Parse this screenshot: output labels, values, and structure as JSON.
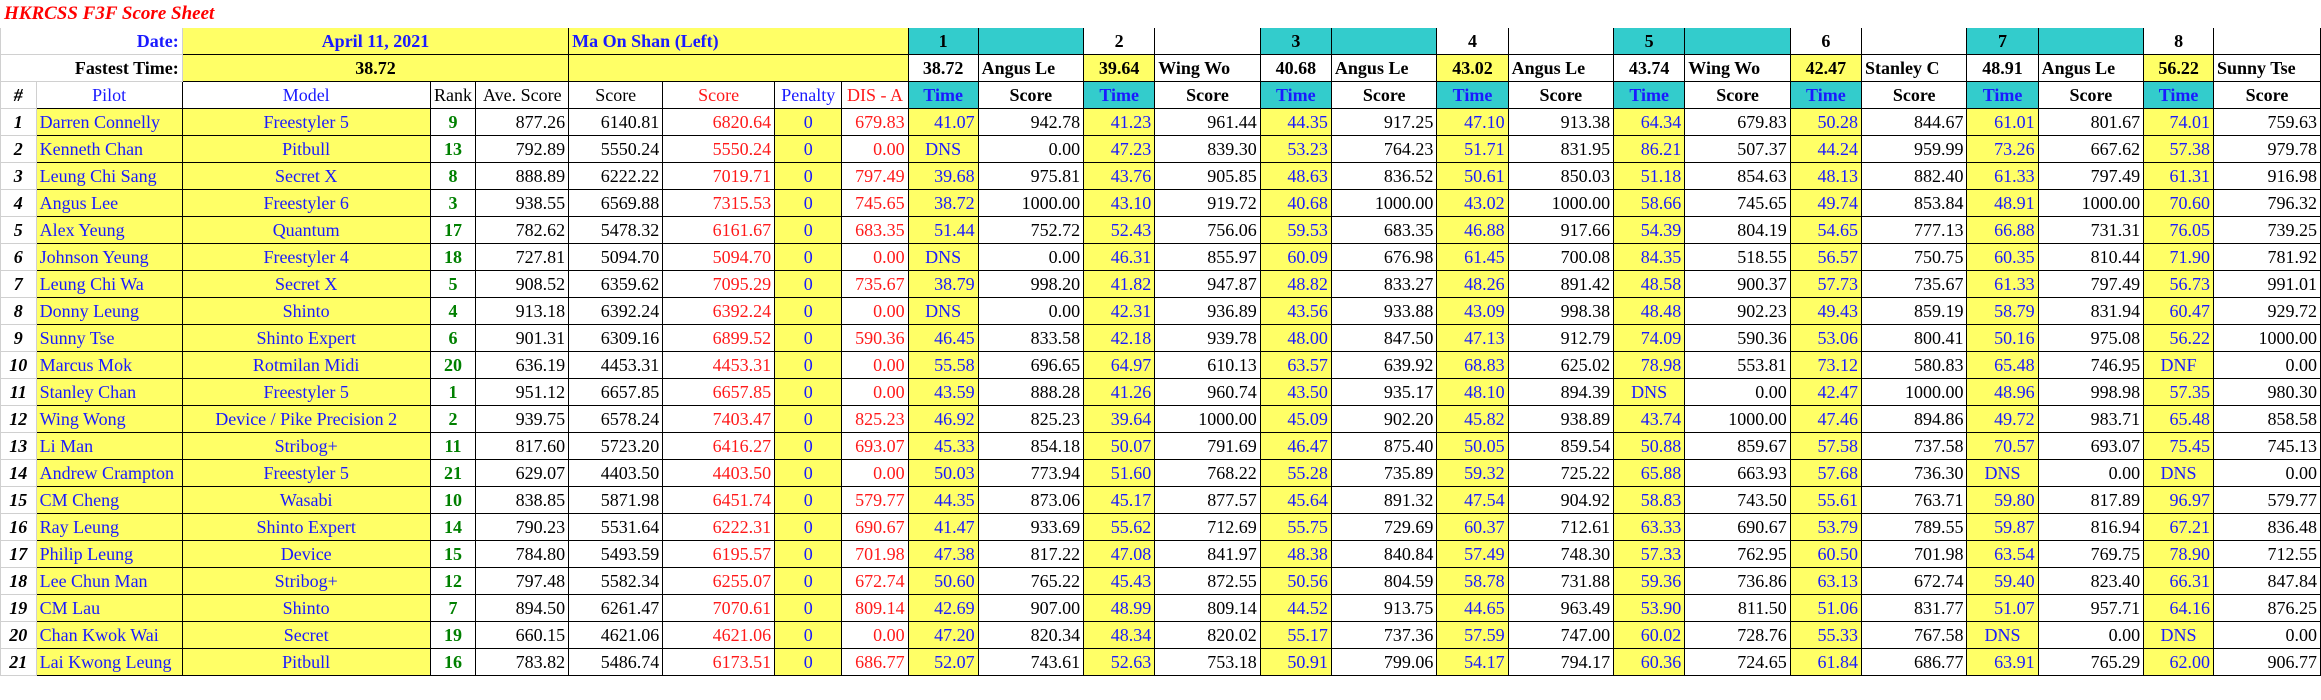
{
  "title": "HKRCSS F3F Score Sheet",
  "date_label": "Date:",
  "date_value": "April 11, 2021",
  "site": "Ma On Shan (Left)",
  "fastest_label": "Fastest Time:",
  "fastest_value": "38.72",
  "rounds": [
    {
      "number": "1",
      "best_time": "38.72",
      "best_pilot": "Angus Le"
    },
    {
      "number": "2",
      "best_time": "39.64",
      "best_pilot": "Wing Wo"
    },
    {
      "number": "3",
      "best_time": "40.68",
      "best_pilot": "Angus Le"
    },
    {
      "number": "4",
      "best_time": "43.02",
      "best_pilot": "Angus Le"
    },
    {
      "number": "5",
      "best_time": "43.74",
      "best_pilot": "Wing Wo"
    },
    {
      "number": "6",
      "best_time": "42.47",
      "best_pilot": "Stanley C"
    },
    {
      "number": "7",
      "best_time": "48.91",
      "best_pilot": "Angus Le"
    },
    {
      "number": "8",
      "best_time": "56.22",
      "best_pilot": "Sunny Tse"
    }
  ],
  "headers": {
    "num": "#",
    "pilot": "Pilot",
    "model": "Model",
    "rank": "Rank",
    "ave_score": "Ave. Score",
    "score": "Score",
    "score_red": "Score",
    "penalty": "Penalty",
    "dis": "DIS - A",
    "time": "Time",
    "round_score": "Score"
  },
  "pilots": [
    {
      "n": "1",
      "pilot": "Darren Connelly",
      "model": "Freestyler 5",
      "rank": "9",
      "ave": "877.26",
      "score": "6140.81",
      "score2": "6820.64",
      "penalty": "0",
      "dis": "679.83",
      "rounds": [
        [
          "41.07",
          "942.78"
        ],
        [
          "41.23",
          "961.44"
        ],
        [
          "44.35",
          "917.25"
        ],
        [
          "47.10",
          "913.38"
        ],
        [
          "64.34",
          "679.83"
        ],
        [
          "50.28",
          "844.67"
        ],
        [
          "61.01",
          "801.67"
        ],
        [
          "74.01",
          "759.63"
        ]
      ]
    },
    {
      "n": "2",
      "pilot": "Kenneth Chan",
      "model": "Pitbull",
      "rank": "13",
      "ave": "792.89",
      "score": "5550.24",
      "score2": "5550.24",
      "penalty": "0",
      "dis": "0.00",
      "rounds": [
        [
          "DNS",
          "0.00"
        ],
        [
          "47.23",
          "839.30"
        ],
        [
          "53.23",
          "764.23"
        ],
        [
          "51.71",
          "831.95"
        ],
        [
          "86.21",
          "507.37"
        ],
        [
          "44.24",
          "959.99"
        ],
        [
          "73.26",
          "667.62"
        ],
        [
          "57.38",
          "979.78"
        ]
      ]
    },
    {
      "n": "3",
      "pilot": "Leung Chi Sang",
      "model": "Secret X",
      "rank": "8",
      "ave": "888.89",
      "score": "6222.22",
      "score2": "7019.71",
      "penalty": "0",
      "dis": "797.49",
      "rounds": [
        [
          "39.68",
          "975.81"
        ],
        [
          "43.76",
          "905.85"
        ],
        [
          "48.63",
          "836.52"
        ],
        [
          "50.61",
          "850.03"
        ],
        [
          "51.18",
          "854.63"
        ],
        [
          "48.13",
          "882.40"
        ],
        [
          "61.33",
          "797.49"
        ],
        [
          "61.31",
          "916.98"
        ]
      ]
    },
    {
      "n": "4",
      "pilot": "Angus Lee",
      "model": "Freestyler 6",
      "rank": "3",
      "ave": "938.55",
      "score": "6569.88",
      "score2": "7315.53",
      "penalty": "0",
      "dis": "745.65",
      "rounds": [
        [
          "38.72",
          "1000.00"
        ],
        [
          "43.10",
          "919.72"
        ],
        [
          "40.68",
          "1000.00"
        ],
        [
          "43.02",
          "1000.00"
        ],
        [
          "58.66",
          "745.65"
        ],
        [
          "49.74",
          "853.84"
        ],
        [
          "48.91",
          "1000.00"
        ],
        [
          "70.60",
          "796.32"
        ]
      ]
    },
    {
      "n": "5",
      "pilot": "Alex Yeung",
      "model": "Quantum",
      "rank": "17",
      "ave": "782.62",
      "score": "5478.32",
      "score2": "6161.67",
      "penalty": "0",
      "dis": "683.35",
      "rounds": [
        [
          "51.44",
          "752.72"
        ],
        [
          "52.43",
          "756.06"
        ],
        [
          "59.53",
          "683.35"
        ],
        [
          "46.88",
          "917.66"
        ],
        [
          "54.39",
          "804.19"
        ],
        [
          "54.65",
          "777.13"
        ],
        [
          "66.88",
          "731.31"
        ],
        [
          "76.05",
          "739.25"
        ]
      ]
    },
    {
      "n": "6",
      "pilot": "Johnson Yeung",
      "model": "Freestyler 4",
      "rank": "18",
      "ave": "727.81",
      "score": "5094.70",
      "score2": "5094.70",
      "penalty": "0",
      "dis": "0.00",
      "rounds": [
        [
          "DNS",
          "0.00"
        ],
        [
          "46.31",
          "855.97"
        ],
        [
          "60.09",
          "676.98"
        ],
        [
          "61.45",
          "700.08"
        ],
        [
          "84.35",
          "518.55"
        ],
        [
          "56.57",
          "750.75"
        ],
        [
          "60.35",
          "810.44"
        ],
        [
          "71.90",
          "781.92"
        ]
      ]
    },
    {
      "n": "7",
      "pilot": "Leung Chi Wa",
      "model": "Secret X",
      "rank": "5",
      "ave": "908.52",
      "score": "6359.62",
      "score2": "7095.29",
      "penalty": "0",
      "dis": "735.67",
      "rounds": [
        [
          "38.79",
          "998.20"
        ],
        [
          "41.82",
          "947.87"
        ],
        [
          "48.82",
          "833.27"
        ],
        [
          "48.26",
          "891.42"
        ],
        [
          "48.58",
          "900.37"
        ],
        [
          "57.73",
          "735.67"
        ],
        [
          "61.33",
          "797.49"
        ],
        [
          "56.73",
          "991.01"
        ]
      ]
    },
    {
      "n": "8",
      "pilot": "Donny Leung",
      "model": "Shinto",
      "rank": "4",
      "ave": "913.18",
      "score": "6392.24",
      "score2": "6392.24",
      "penalty": "0",
      "dis": "0.00",
      "rounds": [
        [
          "DNS",
          "0.00"
        ],
        [
          "42.31",
          "936.89"
        ],
        [
          "43.56",
          "933.88"
        ],
        [
          "43.09",
          "998.38"
        ],
        [
          "48.48",
          "902.23"
        ],
        [
          "49.43",
          "859.19"
        ],
        [
          "58.79",
          "831.94"
        ],
        [
          "60.47",
          "929.72"
        ]
      ]
    },
    {
      "n": "9",
      "pilot": "Sunny Tse",
      "model": "Shinto Expert",
      "rank": "6",
      "ave": "901.31",
      "score": "6309.16",
      "score2": "6899.52",
      "penalty": "0",
      "dis": "590.36",
      "rounds": [
        [
          "46.45",
          "833.58"
        ],
        [
          "42.18",
          "939.78"
        ],
        [
          "48.00",
          "847.50"
        ],
        [
          "47.13",
          "912.79"
        ],
        [
          "74.09",
          "590.36"
        ],
        [
          "53.06",
          "800.41"
        ],
        [
          "50.16",
          "975.08"
        ],
        [
          "56.22",
          "1000.00"
        ]
      ]
    },
    {
      "n": "10",
      "pilot": "Marcus Mok",
      "model": "Rotmilan Midi",
      "rank": "20",
      "ave": "636.19",
      "score": "4453.31",
      "score2": "4453.31",
      "penalty": "0",
      "dis": "0.00",
      "rounds": [
        [
          "55.58",
          "696.65"
        ],
        [
          "64.97",
          "610.13"
        ],
        [
          "63.57",
          "639.92"
        ],
        [
          "68.83",
          "625.02"
        ],
        [
          "78.98",
          "553.81"
        ],
        [
          "73.12",
          "580.83"
        ],
        [
          "65.48",
          "746.95"
        ],
        [
          "DNF",
          "0.00"
        ]
      ]
    },
    {
      "n": "11",
      "pilot": "Stanley Chan",
      "model": "Freestyler 5",
      "rank": "1",
      "ave": "951.12",
      "score": "6657.85",
      "score2": "6657.85",
      "penalty": "0",
      "dis": "0.00",
      "rounds": [
        [
          "43.59",
          "888.28"
        ],
        [
          "41.26",
          "960.74"
        ],
        [
          "43.50",
          "935.17"
        ],
        [
          "48.10",
          "894.39"
        ],
        [
          "DNS",
          "0.00"
        ],
        [
          "42.47",
          "1000.00"
        ],
        [
          "48.96",
          "998.98"
        ],
        [
          "57.35",
          "980.30"
        ]
      ]
    },
    {
      "n": "12",
      "pilot": "Wing Wong",
      "model": "Device / Pike Precision 2",
      "rank": "2",
      "ave": "939.75",
      "score": "6578.24",
      "score2": "7403.47",
      "penalty": "0",
      "dis": "825.23",
      "rounds": [
        [
          "46.92",
          "825.23"
        ],
        [
          "39.64",
          "1000.00"
        ],
        [
          "45.09",
          "902.20"
        ],
        [
          "45.82",
          "938.89"
        ],
        [
          "43.74",
          "1000.00"
        ],
        [
          "47.46",
          "894.86"
        ],
        [
          "49.72",
          "983.71"
        ],
        [
          "65.48",
          "858.58"
        ]
      ]
    },
    {
      "n": "13",
      "pilot": "Li Man",
      "model": "Stribog+",
      "rank": "11",
      "ave": "817.60",
      "score": "5723.20",
      "score2": "6416.27",
      "penalty": "0",
      "dis": "693.07",
      "rounds": [
        [
          "45.33",
          "854.18"
        ],
        [
          "50.07",
          "791.69"
        ],
        [
          "46.47",
          "875.40"
        ],
        [
          "50.05",
          "859.54"
        ],
        [
          "50.88",
          "859.67"
        ],
        [
          "57.58",
          "737.58"
        ],
        [
          "70.57",
          "693.07"
        ],
        [
          "75.45",
          "745.13"
        ]
      ]
    },
    {
      "n": "14",
      "pilot": "Andrew Crampton",
      "model": "Freestyler 5",
      "rank": "21",
      "ave": "629.07",
      "score": "4403.50",
      "score2": "4403.50",
      "penalty": "0",
      "dis": "0.00",
      "rounds": [
        [
          "50.03",
          "773.94"
        ],
        [
          "51.60",
          "768.22"
        ],
        [
          "55.28",
          "735.89"
        ],
        [
          "59.32",
          "725.22"
        ],
        [
          "65.88",
          "663.93"
        ],
        [
          "57.68",
          "736.30"
        ],
        [
          "DNS",
          "0.00"
        ],
        [
          "DNS",
          "0.00"
        ]
      ]
    },
    {
      "n": "15",
      "pilot": "CM Cheng",
      "model": "Wasabi",
      "rank": "10",
      "ave": "838.85",
      "score": "5871.98",
      "score2": "6451.74",
      "penalty": "0",
      "dis": "579.77",
      "rounds": [
        [
          "44.35",
          "873.06"
        ],
        [
          "45.17",
          "877.57"
        ],
        [
          "45.64",
          "891.32"
        ],
        [
          "47.54",
          "904.92"
        ],
        [
          "58.83",
          "743.50"
        ],
        [
          "55.61",
          "763.71"
        ],
        [
          "59.80",
          "817.89"
        ],
        [
          "96.97",
          "579.77"
        ]
      ]
    },
    {
      "n": "16",
      "pilot": "Ray Leung",
      "model": "Shinto Expert",
      "rank": "14",
      "ave": "790.23",
      "score": "5531.64",
      "score2": "6222.31",
      "penalty": "0",
      "dis": "690.67",
      "rounds": [
        [
          "41.47",
          "933.69"
        ],
        [
          "55.62",
          "712.69"
        ],
        [
          "55.75",
          "729.69"
        ],
        [
          "60.37",
          "712.61"
        ],
        [
          "63.33",
          "690.67"
        ],
        [
          "53.79",
          "789.55"
        ],
        [
          "59.87",
          "816.94"
        ],
        [
          "67.21",
          "836.48"
        ]
      ]
    },
    {
      "n": "17",
      "pilot": "Philip Leung",
      "model": "Device",
      "rank": "15",
      "ave": "784.80",
      "score": "5493.59",
      "score2": "6195.57",
      "penalty": "0",
      "dis": "701.98",
      "rounds": [
        [
          "47.38",
          "817.22"
        ],
        [
          "47.08",
          "841.97"
        ],
        [
          "48.38",
          "840.84"
        ],
        [
          "57.49",
          "748.30"
        ],
        [
          "57.33",
          "762.95"
        ],
        [
          "60.50",
          "701.98"
        ],
        [
          "63.54",
          "769.75"
        ],
        [
          "78.90",
          "712.55"
        ]
      ]
    },
    {
      "n": "18",
      "pilot": "Lee Chun Man",
      "model": "Stribog+",
      "rank": "12",
      "ave": "797.48",
      "score": "5582.34",
      "score2": "6255.07",
      "penalty": "0",
      "dis": "672.74",
      "rounds": [
        [
          "50.60",
          "765.22"
        ],
        [
          "45.43",
          "872.55"
        ],
        [
          "50.56",
          "804.59"
        ],
        [
          "58.78",
          "731.88"
        ],
        [
          "59.36",
          "736.86"
        ],
        [
          "63.13",
          "672.74"
        ],
        [
          "59.40",
          "823.40"
        ],
        [
          "66.31",
          "847.84"
        ]
      ]
    },
    {
      "n": "19",
      "pilot": "CM Lau",
      "model": "Shinto",
      "rank": "7",
      "ave": "894.50",
      "score": "6261.47",
      "score2": "7070.61",
      "penalty": "0",
      "dis": "809.14",
      "rounds": [
        [
          "42.69",
          "907.00"
        ],
        [
          "48.99",
          "809.14"
        ],
        [
          "44.52",
          "913.75"
        ],
        [
          "44.65",
          "963.49"
        ],
        [
          "53.90",
          "811.50"
        ],
        [
          "51.06",
          "831.77"
        ],
        [
          "51.07",
          "957.71"
        ],
        [
          "64.16",
          "876.25"
        ]
      ]
    },
    {
      "n": "20",
      "pilot": "Chan Kwok Wai",
      "model": "Secret",
      "rank": "19",
      "ave": "660.15",
      "score": "4621.06",
      "score2": "4621.06",
      "penalty": "0",
      "dis": "0.00",
      "rounds": [
        [
          "47.20",
          "820.34"
        ],
        [
          "48.34",
          "820.02"
        ],
        [
          "55.17",
          "737.36"
        ],
        [
          "57.59",
          "747.00"
        ],
        [
          "60.02",
          "728.76"
        ],
        [
          "55.33",
          "767.58"
        ],
        [
          "DNS",
          "0.00"
        ],
        [
          "DNS",
          "0.00"
        ]
      ]
    },
    {
      "n": "21",
      "pilot": "Lai Kwong Leung",
      "model": "Pitbull",
      "rank": "16",
      "ave": "783.82",
      "score": "5486.74",
      "score2": "6173.51",
      "penalty": "0",
      "dis": "686.77",
      "rounds": [
        [
          "52.07",
          "743.61"
        ],
        [
          "52.63",
          "753.18"
        ],
        [
          "50.91",
          "799.06"
        ],
        [
          "54.17",
          "794.17"
        ],
        [
          "60.36",
          "724.65"
        ],
        [
          "61.84",
          "686.77"
        ],
        [
          "63.91",
          "765.29"
        ],
        [
          "62.00",
          "906.77"
        ]
      ]
    }
  ]
}
